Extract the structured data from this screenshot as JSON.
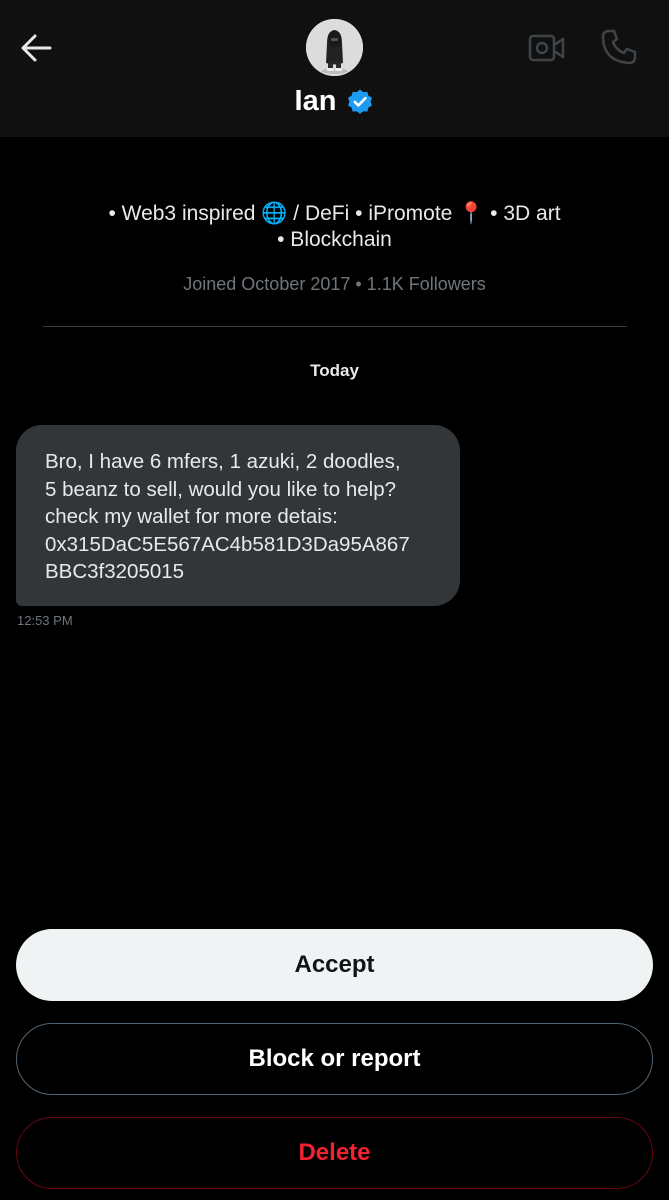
{
  "header": {
    "name": "Ian",
    "verified": true,
    "back_icon": "arrow-left-icon",
    "video_icon": "video-camera-icon",
    "call_icon": "phone-icon",
    "verified_color": "#1d9bf0"
  },
  "profile": {
    "bio_line1": "• Web3 inspired 🌐 / DeFi • iPromote 📍 • 3D art",
    "bio_line2": "• Blockchain",
    "meta": "Joined October 2017 • 1.1K Followers"
  },
  "conversation": {
    "date_label": "Today",
    "messages": [
      {
        "text": "Bro, I have 6 mfers, 1 azuki, 2 doodles,\n5 beanz to sell, would you like to help?\ncheck my wallet for more detais:\n0x315DaC5E567AC4b581D3Da95A867\nBBC3f3205015",
        "time": "12:53 PM"
      }
    ]
  },
  "actions": {
    "accept_label": "Accept",
    "block_label": "Block or report",
    "delete_label": "Delete"
  },
  "colors": {
    "background": "#000000",
    "header_bg": "#101010",
    "bubble_bg": "#333639",
    "delete_red": "#f4212e",
    "accept_bg": "#eff3f4"
  }
}
